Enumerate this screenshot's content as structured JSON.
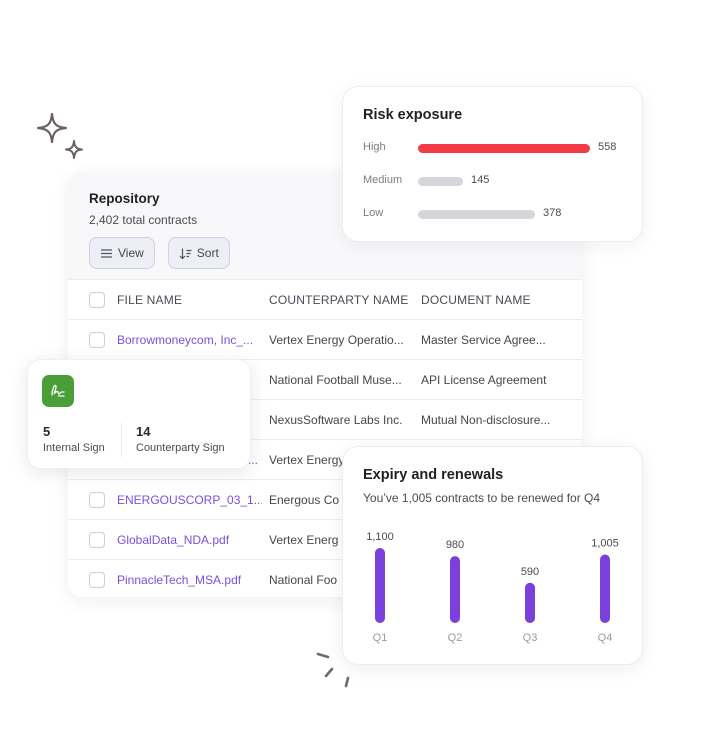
{
  "repository": {
    "title": "Repository",
    "subtitle": "2,402 total contracts",
    "buttons": {
      "view": "View",
      "sort": "Sort"
    },
    "columns": [
      "FILE NAME",
      "COUNTERPARTY NAME",
      "DOCUMENT NAME"
    ],
    "rows": [
      {
        "file": "Borrowmoneycom, Inc_...",
        "counterparty": "Vertex Energy Operatio...",
        "document": "Master Service Agree..."
      },
      {
        "file": "...",
        "counterparty": "National Football Muse...",
        "document": "API License Agreement"
      },
      {
        "file": "",
        "counterparty": "NexusSoftware Labs Inc.",
        "document": "Mutual Non-disclosure..."
      },
      {
        "file": "...",
        "counterparty": "Vertex Energy",
        "document": ""
      },
      {
        "file": "ENERGOUSCORP_03_1...",
        "counterparty": "Energous Co",
        "document": ""
      },
      {
        "file": "GlobalData_NDA.pdf",
        "counterparty": "Vertex Energ",
        "document": ""
      },
      {
        "file": "PinnacleTech_MSA.pdf",
        "counterparty": "National Foo",
        "document": ""
      }
    ]
  },
  "sign": {
    "icon": "signature-icon",
    "stats": [
      {
        "value": "5",
        "label": "Internal Sign"
      },
      {
        "value": "14",
        "label": "Counterparty Sign"
      }
    ]
  },
  "risk": {
    "title": "Risk exposure",
    "max": 558,
    "items": [
      {
        "label": "High",
        "value": 558,
        "display": "558",
        "color": "#f23b47"
      },
      {
        "label": "Medium",
        "value": 145,
        "display": "145",
        "color": "#d6d5dc"
      },
      {
        "label": "Low",
        "value": 378,
        "display": "378",
        "color": "#d6d5dc"
      }
    ]
  },
  "expiry": {
    "title": "Expiry and renewals",
    "subtitle": "You’ve 1,005 contracts to be renewed for Q4"
  },
  "chart_data": {
    "type": "bar",
    "title": "Expiry and renewals",
    "categories": [
      "Q1",
      "Q2",
      "Q3",
      "Q4"
    ],
    "values": [
      1100,
      980,
      590,
      1005
    ],
    "labels": [
      "1,100",
      "980",
      "590",
      "1,005"
    ],
    "color": "#7b3fdc",
    "xlabel": "",
    "ylabel": "",
    "ylim": [
      0,
      1100
    ],
    "grid": false
  }
}
